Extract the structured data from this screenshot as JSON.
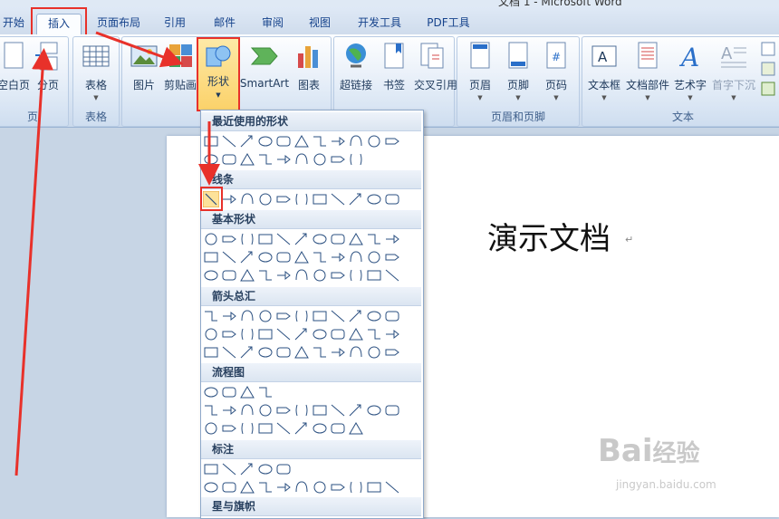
{
  "window": {
    "title": "文档 1 - Microsoft Word"
  },
  "tabs": [
    "开始",
    "插入",
    "页面布局",
    "引用",
    "邮件",
    "审阅",
    "视图",
    "开发工具",
    "PDF工具"
  ],
  "ribbon": {
    "groups": {
      "page": {
        "label": "页",
        "blank_page": "空白页",
        "page_break": "分页"
      },
      "table": {
        "label": "表格",
        "table": "表格"
      },
      "illustrations": {
        "picture": "图片",
        "clipart": "剪贴画",
        "shapes": "形状",
        "smartart": "SmartArt",
        "chart": "图表"
      },
      "links": {
        "hyperlink": "超链接",
        "bookmark": "书签",
        "cross_ref": "交叉引用"
      },
      "header_footer": {
        "label": "页眉和页脚",
        "header": "页眉",
        "footer": "页脚",
        "page_number": "页码"
      },
      "text": {
        "label": "文本",
        "textbox": "文本框",
        "doc_parts": "文档部件",
        "wordart": "艺术字",
        "dropcap": "首字下沉"
      }
    }
  },
  "gallery": {
    "sections": [
      "最近使用的形状",
      "线条",
      "基本形状",
      "箭头总汇",
      "流程图",
      "标注",
      "星与旗帜"
    ]
  },
  "document": {
    "text": "演示文档",
    "para_mark": "↵"
  },
  "watermark": {
    "brand": "Bai",
    "brand2": "经验",
    "url": "jingyan.baidu.com"
  },
  "colors": {
    "highlight": "#e8312a",
    "accent": "#15428b"
  }
}
